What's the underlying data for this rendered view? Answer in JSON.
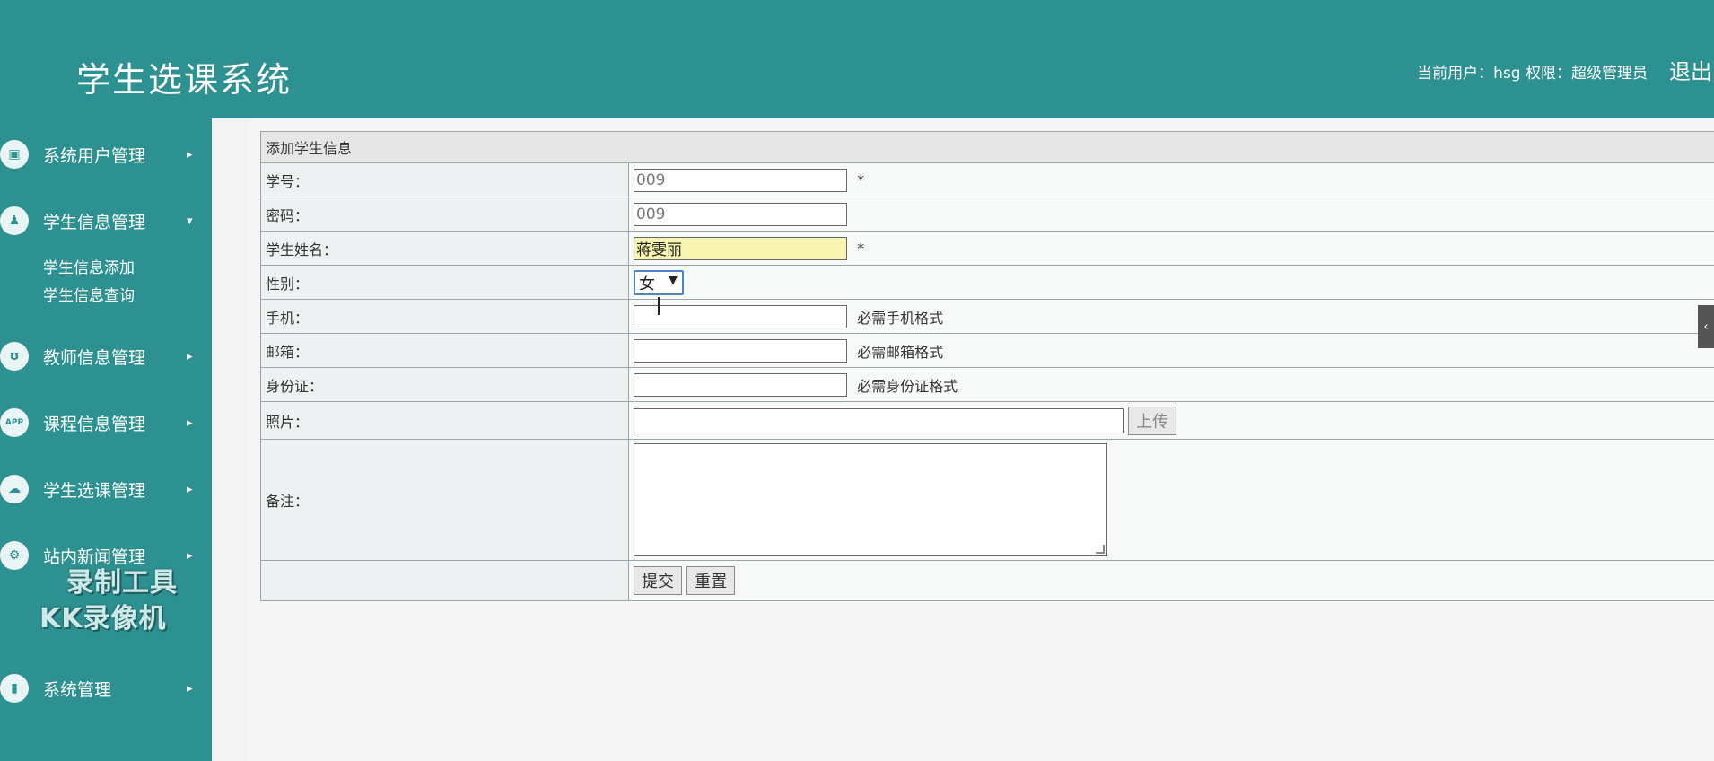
{
  "header": {
    "title": "学生选课系统",
    "user_info": "当前用户：hsg  权限：超级管理员",
    "logout": "退出"
  },
  "sidebar": {
    "items": [
      {
        "label": "系统用户管理",
        "icon": "monitor-icon",
        "arrow": "▸"
      },
      {
        "label": "学生信息管理",
        "icon": "user-icon",
        "arrow": "▾"
      },
      {
        "label": "教师信息管理",
        "icon": "teacher-icon",
        "arrow": "▸"
      },
      {
        "label": "课程信息管理",
        "icon": "app-icon",
        "arrow": "▸"
      },
      {
        "label": "学生选课管理",
        "icon": "cloud-icon",
        "arrow": "▸"
      },
      {
        "label": "站内新闻管理",
        "icon": "gear-icon",
        "arrow": "▸"
      },
      {
        "label": "系统管理",
        "icon": "chart-icon",
        "arrow": "▸"
      }
    ],
    "sub_items": [
      "学生信息添加",
      "学生信息查询"
    ],
    "icon_glyphs": [
      "▣",
      "♟",
      "ʊ",
      "APP",
      "☁",
      "⚙",
      "▮"
    ]
  },
  "form": {
    "caption": "添加学生信息",
    "student_no_label": "学号：",
    "student_no_value": "009",
    "required_mark": "*",
    "password_label": "密码：",
    "password_value": "009",
    "name_label": "学生姓名：",
    "name_value": "蒋雯丽",
    "gender_label": "性别：",
    "gender_value": "女",
    "phone_label": "手机：",
    "phone_hint": "必需手机格式",
    "email_label": "邮箱：",
    "email_hint": "必需邮箱格式",
    "id_label": "身份证：",
    "id_hint": "必需身份证格式",
    "photo_label": "照片：",
    "upload_button": "上传",
    "remark_label": "备注：",
    "submit_button": "提交",
    "reset_button": "重置"
  },
  "watermark": {
    "line1": "录制工具",
    "line2": "KK录像机"
  },
  "colors": {
    "theme": "#2e9191",
    "highlight_input": "#f8f5b0"
  }
}
